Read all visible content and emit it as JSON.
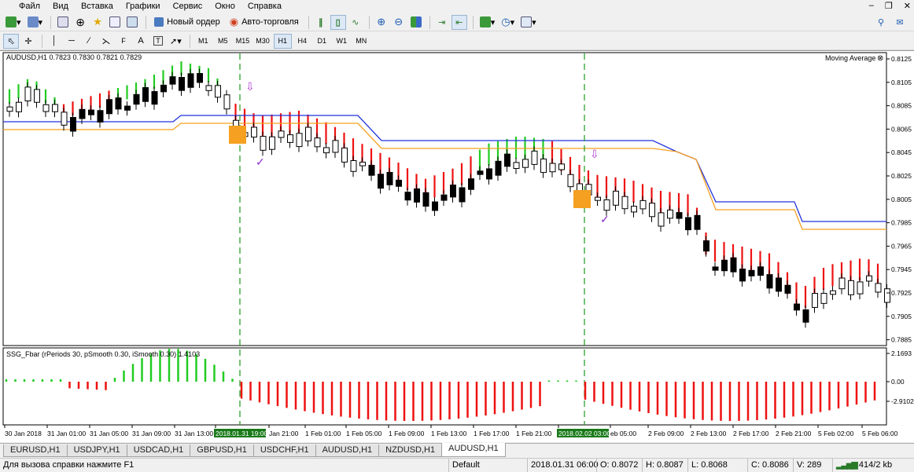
{
  "menu": {
    "items": [
      "Файл",
      "Вид",
      "Вставка",
      "Графики",
      "Сервис",
      "Окно",
      "Справка"
    ]
  },
  "toolbar": {
    "new_order_label": "Новый ордер",
    "autotrading_label": "Авто-торговля",
    "timeframes": [
      "M1",
      "M5",
      "M15",
      "M30",
      "H1",
      "H4",
      "D1",
      "W1",
      "MN"
    ],
    "active_timeframe": "H1"
  },
  "chart": {
    "header": "AUDUSD,H1  0.7823 0.7830 0.7821 0.7829",
    "indicator_label": "Moving Average",
    "subwindow_label": "SSG_Fbar  (rPeriods 30, pSmooth 0.30, iSmooth 0.30)  1.4103",
    "price_ticks": [
      "0.8125",
      "0.8105",
      "0.8085",
      "0.8065",
      "0.8045",
      "0.8025",
      "0.8005",
      "0.7985",
      "0.7965",
      "0.7945",
      "0.7925",
      "0.7905",
      "0.7885"
    ],
    "sub_ticks": [
      "2.1693",
      "0.00",
      "-2.9102"
    ],
    "time_labels": [
      "30 Jan 2018",
      "31 Jan 01:00",
      "31 Jan 05:00",
      "31 Jan 09:00",
      "31 Jan 13:00",
      "2018.01.31 19:00",
      "Jan 21:00",
      "1 Feb 01:00",
      "1 Feb 05:00",
      "1 Feb 09:00",
      "1 Feb 13:00",
      "1 Feb 17:00",
      "1 Feb 21:00",
      "2018.02.02 03:00",
      "eb 05:00",
      "2 Feb 09:00",
      "2 Feb 13:00",
      "2 Feb 17:00",
      "2 Feb 21:00",
      "5 Feb 02:00",
      "5 Feb 06:00"
    ],
    "highlighted_times": [
      "2018.01.31 19:00",
      "2018.02.02 03:00"
    ],
    "colors": {
      "bull_bar": "#22cc22",
      "bear_bar": "#ee1111",
      "ma_blue": "#2233dd",
      "ma_orange": "#f5a020",
      "signal_box": "#f5a020",
      "vline": "#1a9a1a",
      "arrow": "#b040d0",
      "check": "#8a2bd0"
    }
  },
  "tabs": {
    "items": [
      "EURUSD,H1",
      "USDJPY,H1",
      "USDCAD,H1",
      "GBPUSD,H1",
      "USDCHF,H1",
      "AUDUSD,H1",
      "NZDUSD,H1",
      "AUDUSD,H1"
    ],
    "active_index": 7
  },
  "status": {
    "help": "Для вызова справки нажмите F1",
    "profile": "Default",
    "datetime": "2018.01.31 06:00",
    "open": "O: 0.8072",
    "high": "H: 0.8087",
    "low": "L: 0.8068",
    "close": "C: 0.8086",
    "volume": "V: 289",
    "traffic": "414/2 kb"
  }
}
